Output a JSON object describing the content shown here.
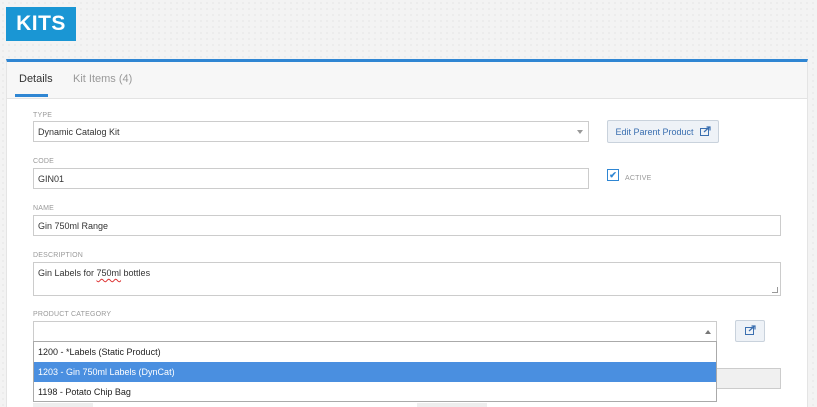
{
  "page": {
    "title": "KITS"
  },
  "tabs": [
    {
      "label": "Details",
      "active": true
    },
    {
      "label": "Kit Items (4)",
      "active": false
    }
  ],
  "form": {
    "type": {
      "label": "TYPE",
      "value": "Dynamic Catalog Kit"
    },
    "edit_parent_button": {
      "label": "Edit Parent Product",
      "icon": "share-icon"
    },
    "code": {
      "label": "CODE",
      "value": "GIN01"
    },
    "active": {
      "label": "ACTIVE",
      "checked": true
    },
    "name": {
      "label": "NAME",
      "value": "Gin 750ml Range"
    },
    "description": {
      "label": "DESCRIPTION",
      "value_prefix": "Gin Labels for ",
      "value_misspelled": "750ml",
      "value_suffix": " bottles"
    },
    "product_category": {
      "label": "PRODUCT CATEGORY",
      "value": "",
      "options": [
        {
          "label": "1200 - *Labels (Static Product)",
          "selected": false
        },
        {
          "label": "1203 - Gin 750ml Labels (DynCat)",
          "selected": true
        },
        {
          "label": "1198 - Potato Chip Bag",
          "selected": false
        }
      ]
    }
  },
  "colors": {
    "accent": "#1a96d4",
    "tab_accent": "#2f86d3",
    "selected_option": "#4a8fe0"
  }
}
